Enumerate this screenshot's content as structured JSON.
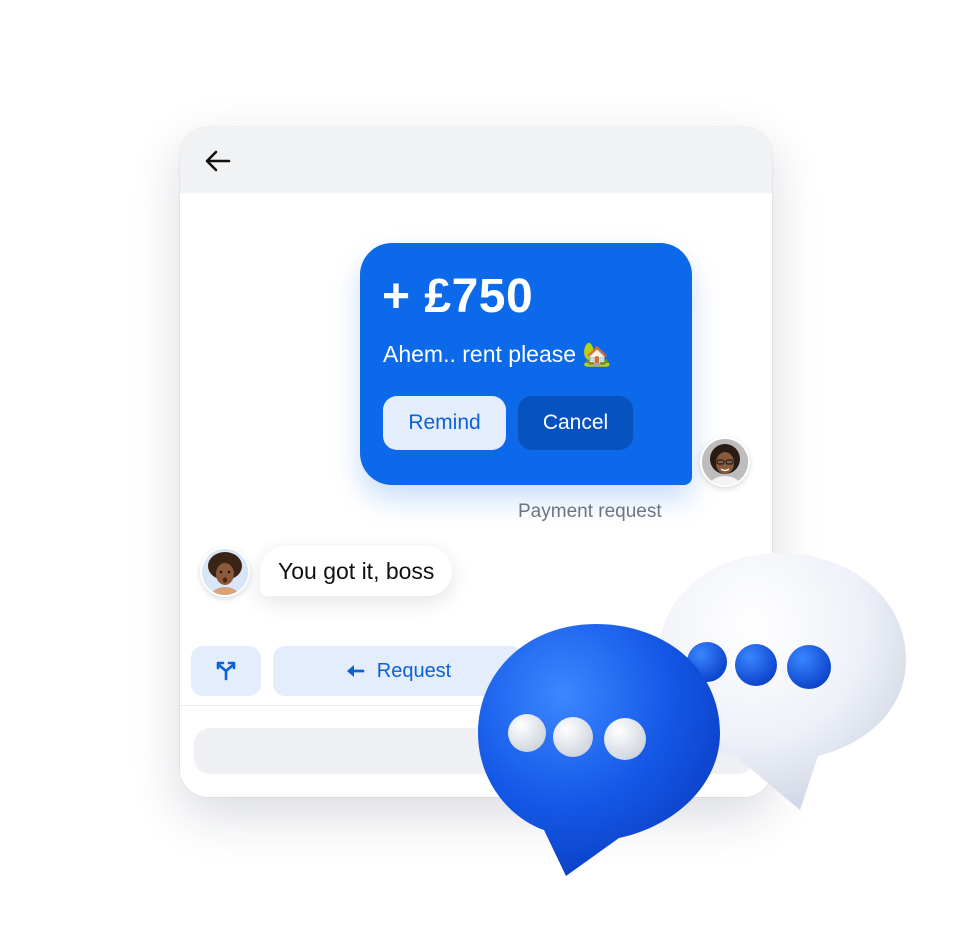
{
  "header": {
    "back_icon": "arrow-left-icon"
  },
  "payment_request": {
    "amount": "+ £750",
    "note": "Ahem.. rent please 🏡",
    "remind_label": "Remind",
    "cancel_label": "Cancel",
    "caption": "Payment request"
  },
  "reply": {
    "text": "You got it, boss"
  },
  "actions": {
    "split_icon": "split-arrows-icon",
    "request_icon": "arrow-left-icon",
    "request_label": "Request"
  },
  "composer": {
    "placeholder": ""
  },
  "colors": {
    "accent": "#0b69ea",
    "accent_dark": "#0852c0",
    "accent_light": "#e4edfb",
    "caption_gray": "#6d7580"
  }
}
